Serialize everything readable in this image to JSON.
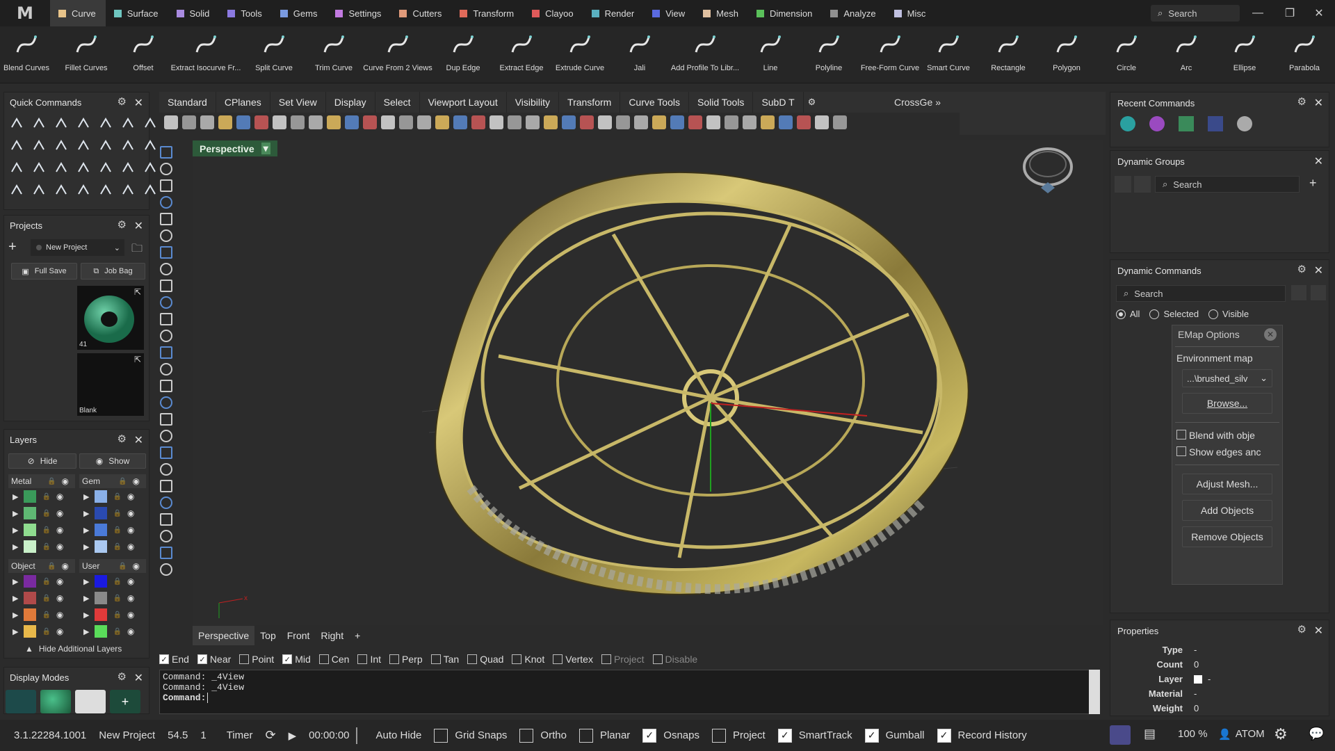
{
  "menubar": {
    "logo": "M",
    "tabs": [
      {
        "label": "Curve",
        "color": "#e8c48a",
        "active": true
      },
      {
        "label": "Surface",
        "color": "#6fc6c0"
      },
      {
        "label": "Solid",
        "color": "#a98be0"
      },
      {
        "label": "Tools",
        "color": "#8b79e0"
      },
      {
        "label": "Gems",
        "color": "#7a9ae0"
      },
      {
        "label": "Settings",
        "color": "#c27ae0"
      },
      {
        "label": "Cutters",
        "color": "#e09a7a"
      },
      {
        "label": "Transform",
        "color": "#e06a5a"
      },
      {
        "label": "Clayoo",
        "color": "#e05a5a"
      },
      {
        "label": "Render",
        "color": "#5ab0c0"
      },
      {
        "label": "View",
        "color": "#5a6ae0"
      },
      {
        "label": "Mesh",
        "color": "#e0c0a0"
      },
      {
        "label": "Dimension",
        "color": "#5ac05a"
      },
      {
        "label": "Analyze",
        "color": "#909090"
      },
      {
        "label": "Misc",
        "color": "#c0c0e0"
      }
    ],
    "search_placeholder": "Search"
  },
  "ribbon": [
    {
      "label": "Blend Curves",
      "icon": "blend-curves-icon"
    },
    {
      "label": "Fillet Curves",
      "icon": "fillet-curves-icon"
    },
    {
      "label": "Offset",
      "icon": "offset-icon"
    },
    {
      "label": "Extract Isocurve Fr...",
      "icon": "extract-isocurve-icon"
    },
    {
      "label": "Split Curve",
      "icon": "split-curve-icon"
    },
    {
      "label": "Trim Curve",
      "icon": "trim-curve-icon"
    },
    {
      "label": "Curve From 2 Views",
      "icon": "curve-from-2-views-icon"
    },
    {
      "label": "Dup Edge",
      "icon": "dup-edge-icon"
    },
    {
      "label": "Extract Edge",
      "icon": "extract-edge-icon"
    },
    {
      "label": "Extrude Curve",
      "icon": "extrude-curve-icon"
    },
    {
      "label": "Jali",
      "icon": "jali-icon"
    },
    {
      "label": "Add Profile To Libr...",
      "icon": "add-profile-icon"
    },
    {
      "label": "Line",
      "icon": "line-icon"
    },
    {
      "label": "Polyline",
      "icon": "polyline-icon"
    },
    {
      "label": "Free-Form Curve",
      "icon": "free-form-curve-icon"
    },
    {
      "label": "Smart Curve",
      "icon": "smart-curve-icon"
    },
    {
      "label": "Rectangle",
      "icon": "rectangle-icon"
    },
    {
      "label": "Polygon",
      "icon": "polygon-icon"
    },
    {
      "label": "Circle",
      "icon": "circle-icon"
    },
    {
      "label": "Arc",
      "icon": "arc-icon"
    },
    {
      "label": "Ellipse",
      "icon": "ellipse-icon"
    },
    {
      "label": "Parabola",
      "icon": "parabola-icon"
    }
  ],
  "quick_commands": {
    "title": "Quick Commands"
  },
  "projects": {
    "title": "Projects",
    "project": "New Project",
    "full_save": "Full Save",
    "job_bag": "Job Bag",
    "thumb1_count": "41",
    "thumb2_label": "Blank"
  },
  "layers": {
    "title": "Layers",
    "hide": "Hide",
    "show": "Show",
    "groups": [
      {
        "name": "Metal",
        "colors": [
          "#3a9a5a",
          "#5fb873",
          "#8fdc8f",
          "#c9f0c9"
        ]
      },
      {
        "name": "Gem",
        "colors": [
          "#8ab0e8",
          "#2a4ab0",
          "#4a7ad8",
          "#aac8f0"
        ]
      },
      {
        "name": "Object",
        "colors": [
          "#7a2aa0",
          "#b04a4a",
          "#e07a3a",
          "#e8b84a"
        ]
      },
      {
        "name": "User",
        "colors": [
          "#1a1ae0",
          "#8a8a8a",
          "#e03a3a",
          "#5adc5a"
        ]
      }
    ],
    "hide_additional": "Hide Additional Layers"
  },
  "display_modes": {
    "title": "Display Modes"
  },
  "toolbar_tabs": [
    "Standard",
    "CPlanes",
    "Set View",
    "Display",
    "Select",
    "Viewport Layout",
    "Visibility",
    "Transform",
    "Curve Tools",
    "Solid Tools",
    "SubD T"
  ],
  "toolbar_tab_extra": "CrossGe",
  "viewport": {
    "label": "Perspective"
  },
  "bottom_tabs": [
    "Perspective",
    "Top",
    "Front",
    "Right"
  ],
  "osnaps": [
    {
      "label": "End",
      "checked": true
    },
    {
      "label": "Near",
      "checked": true
    },
    {
      "label": "Point",
      "checked": false
    },
    {
      "label": "Mid",
      "checked": true
    },
    {
      "label": "Cen",
      "checked": false
    },
    {
      "label": "Int",
      "checked": false
    },
    {
      "label": "Perp",
      "checked": false
    },
    {
      "label": "Tan",
      "checked": false
    },
    {
      "label": "Quad",
      "checked": false
    },
    {
      "label": "Knot",
      "checked": false
    },
    {
      "label": "Vertex",
      "checked": false
    },
    {
      "label": "Project",
      "checked": false
    },
    {
      "label": "Disable",
      "checked": false
    }
  ],
  "command": {
    "history": [
      "Command: _4View",
      "Command: _4View"
    ],
    "prompt": "Command:"
  },
  "status": {
    "version": "3.1.22284.1001",
    "project": "New Project",
    "val1": "54.5",
    "val2": "1",
    "timer": "Timer",
    "time": "00:00:00",
    "autohide": "Auto Hide",
    "toggles": [
      {
        "label": "Grid Snaps",
        "checked": false
      },
      {
        "label": "Ortho",
        "checked": false
      },
      {
        "label": "Planar",
        "checked": false
      },
      {
        "label": "Osnaps",
        "checked": true
      },
      {
        "label": "Project",
        "checked": false
      },
      {
        "label": "SmartTrack",
        "checked": true
      },
      {
        "label": "Gumball",
        "checked": true
      },
      {
        "label": "Record History",
        "checked": true
      }
    ],
    "zoom": "100 %",
    "user": "ATOM"
  },
  "recent_commands": {
    "title": "Recent Commands"
  },
  "dynamic_groups": {
    "title": "Dynamic Groups",
    "search": "Search"
  },
  "dynamic_commands": {
    "title": "Dynamic Commands",
    "search": "Search",
    "filters": [
      {
        "label": "All",
        "selected": true
      },
      {
        "label": "Selected",
        "selected": false
      },
      {
        "label": "Visible",
        "selected": false
      }
    ],
    "emap": {
      "title": "EMap Options",
      "env_label": "Environment map",
      "env_value": "...\\brushed_silv",
      "browse": "Browse...",
      "blend": "Blend with obje",
      "show_edges": "Show edges anc",
      "adjust_mesh": "Adjust Mesh...",
      "add_objects": "Add Objects",
      "remove_objects": "Remove Objects"
    }
  },
  "properties": {
    "title": "Properties",
    "rows": [
      {
        "k": "Type",
        "v": "-"
      },
      {
        "k": "Count",
        "v": "0"
      },
      {
        "k": "Layer",
        "v": "-"
      },
      {
        "k": "Material",
        "v": "-"
      },
      {
        "k": "Weight",
        "v": "0"
      }
    ]
  }
}
